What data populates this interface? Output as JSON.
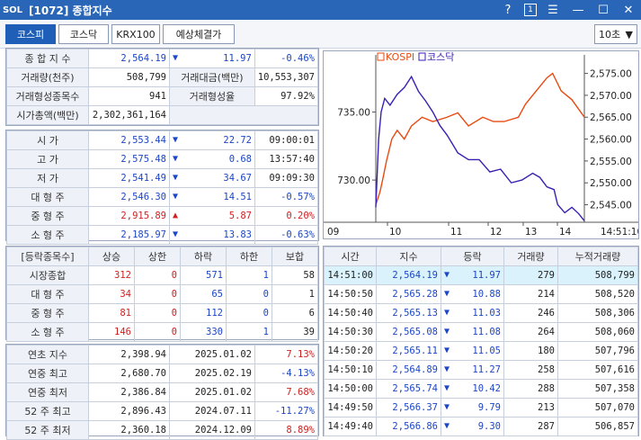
{
  "window": {
    "title": "[1072] 종합지수",
    "logo": "SOL",
    "help": "?",
    "page": "1",
    "menu": "☰",
    "min": "—",
    "max": "☐",
    "close": "✕"
  },
  "tabs": [
    "코스피",
    "코스닥",
    "KRX100",
    "예상체결가"
  ],
  "interval": "10초",
  "summary": [
    {
      "l1": "종 합 지 수",
      "v1": "2,564.19",
      "ch": "▼",
      "v2": "11.97",
      "v3": "-0.46%"
    },
    {
      "l1": "거래량(천주)",
      "v1": "508,799",
      "l2": "거래대금(백만)",
      "v2": "10,553,307"
    },
    {
      "l1": "거래형성종목수",
      "v1": "941",
      "l2": "거래형성율",
      "v2": "97.92%"
    },
    {
      "l1": "시가총액(백만)",
      "v1": "2,302,361,164"
    }
  ],
  "prices": [
    {
      "l": "시      가",
      "v": "2,553.44",
      "d": "▼",
      "c": "22.72",
      "t": "09:00:01",
      "col": "blue"
    },
    {
      "l": "고      가",
      "v": "2,575.48",
      "d": "▼",
      "c": "0.68",
      "t": "13:57:40",
      "col": "blue"
    },
    {
      "l": "저      가",
      "v": "2,541.49",
      "d": "▼",
      "c": "34.67",
      "t": "09:09:30",
      "col": "blue"
    },
    {
      "l": "대 형 주",
      "v": "2,546.30",
      "d": "▼",
      "c": "14.51",
      "t": "-0.57%",
      "col": "blue"
    },
    {
      "l": "중 형 주",
      "v": "2,915.89",
      "d": "▲",
      "c": "5.87",
      "t": "0.20%",
      "col": "red"
    },
    {
      "l": "소 형 주",
      "v": "2,185.97",
      "d": "▼",
      "c": "13.83",
      "t": "-0.63%",
      "col": "blue"
    }
  ],
  "breadth_header": [
    "[등락종목수]",
    "상승",
    "상한",
    "하락",
    "하한",
    "보합"
  ],
  "breadth": [
    {
      "l": "시장종합",
      "a": "312",
      "b": "0",
      "c": "571",
      "d": "1",
      "e": "58"
    },
    {
      "l": "대 형 주",
      "a": "34",
      "b": "0",
      "c": "65",
      "d": "0",
      "e": "1"
    },
    {
      "l": "중 형 주",
      "a": "81",
      "b": "0",
      "c": "112",
      "d": "0",
      "e": "6"
    },
    {
      "l": "소 형 주",
      "a": "146",
      "b": "0",
      "c": "330",
      "d": "1",
      "e": "39"
    }
  ],
  "yearly": [
    {
      "l": "연초  지수",
      "v": "2,398.94",
      "d": "2025.01.02",
      "p": "7.13%",
      "col": "red"
    },
    {
      "l": "연중  최고",
      "v": "2,680.70",
      "d": "2025.02.19",
      "p": "-4.13%",
      "col": "blue"
    },
    {
      "l": "연중  최저",
      "v": "2,386.84",
      "d": "2025.01.02",
      "p": "7.68%",
      "col": "red"
    },
    {
      "l": "52 주 최고",
      "v": "2,896.43",
      "d": "2024.07.11",
      "p": "-11.27%",
      "col": "blue"
    },
    {
      "l": "52 주 최저",
      "v": "2,360.18",
      "d": "2024.12.09",
      "p": "8.89%",
      "col": "red"
    }
  ],
  "ticks_header": [
    "시간",
    "지수",
    "등락",
    "거래량",
    "누적거래량"
  ],
  "ticks": [
    {
      "t": "14:51:00",
      "i": "2,564.19",
      "c": "11.97",
      "v": "279",
      "cv": "508,799"
    },
    {
      "t": "14:50:50",
      "i": "2,565.28",
      "c": "10.88",
      "v": "214",
      "cv": "508,520"
    },
    {
      "t": "14:50:40",
      "i": "2,565.13",
      "c": "11.03",
      "v": "246",
      "cv": "508,306"
    },
    {
      "t": "14:50:30",
      "i": "2,565.08",
      "c": "11.08",
      "v": "264",
      "cv": "508,060"
    },
    {
      "t": "14:50:20",
      "i": "2,565.11",
      "c": "11.05",
      "v": "180",
      "cv": "507,796"
    },
    {
      "t": "14:50:10",
      "i": "2,564.89",
      "c": "11.27",
      "v": "258",
      "cv": "507,616"
    },
    {
      "t": "14:50:00",
      "i": "2,565.74",
      "c": "10.42",
      "v": "288",
      "cv": "507,358"
    },
    {
      "t": "14:49:50",
      "i": "2,566.37",
      "c": "9.79",
      "v": "213",
      "cv": "507,070"
    },
    {
      "t": "14:49:40",
      "i": "2,566.86",
      "c": "9.30",
      "v": "287",
      "cv": "506,857"
    }
  ],
  "chart_data": {
    "type": "line",
    "legend": [
      "KOSPI",
      "코스닥"
    ],
    "x_ticks": [
      "09",
      "10",
      "11",
      "12",
      "13",
      "14",
      "14:51:10"
    ],
    "left_ticks": [
      "735.00",
      "730.00"
    ],
    "right_ticks": [
      "2,575.00",
      "2,570.00",
      "2,565.00",
      "2,560.00",
      "2,555.00",
      "2,550.00",
      "2,545.00"
    ],
    "left_ylim": [
      726.9,
      738.8
    ],
    "right_ylim": [
      2541,
      2578
    ],
    "colors": {
      "kospi": "#e84a10",
      "kosdaq": "#3a1fb0"
    },
    "series": [
      {
        "name": "KOSPI",
        "x": [
          9.0,
          9.12,
          9.2,
          9.3,
          9.45,
          9.6,
          9.8,
          10.0,
          10.3,
          10.6,
          11.0,
          11.3,
          11.6,
          12.0,
          12.3,
          12.6,
          13.0,
          13.2,
          13.4,
          13.6,
          13.8,
          13.96,
          14.2,
          14.5,
          14.85
        ],
        "y": [
          2545,
          2548,
          2551,
          2555,
          2560,
          2562,
          2560,
          2563,
          2565,
          2564,
          2565,
          2566,
          2563,
          2565,
          2564,
          2564,
          2565,
          2568,
          2570,
          2572,
          2574,
          2575,
          2571,
          2569,
          2565
        ]
      },
      {
        "name": "코스닥",
        "x": [
          9.0,
          9.08,
          9.15,
          9.25,
          9.4,
          9.6,
          9.8,
          10.0,
          10.2,
          10.4,
          10.6,
          10.8,
          11.0,
          11.3,
          11.6,
          11.9,
          12.2,
          12.5,
          12.8,
          13.1,
          13.4,
          13.6,
          13.8,
          14.0,
          14.1,
          14.3,
          14.5,
          14.7,
          14.85
        ],
        "y": [
          728.0,
          733.0,
          735.0,
          736.0,
          735.5,
          736.3,
          736.8,
          737.6,
          736.5,
          735.8,
          735.0,
          734.0,
          733.3,
          732.0,
          731.5,
          731.5,
          730.6,
          730.8,
          729.8,
          730.0,
          730.5,
          730.2,
          729.5,
          729.3,
          728.2,
          727.6,
          728.0,
          727.5,
          727.0
        ]
      }
    ]
  }
}
